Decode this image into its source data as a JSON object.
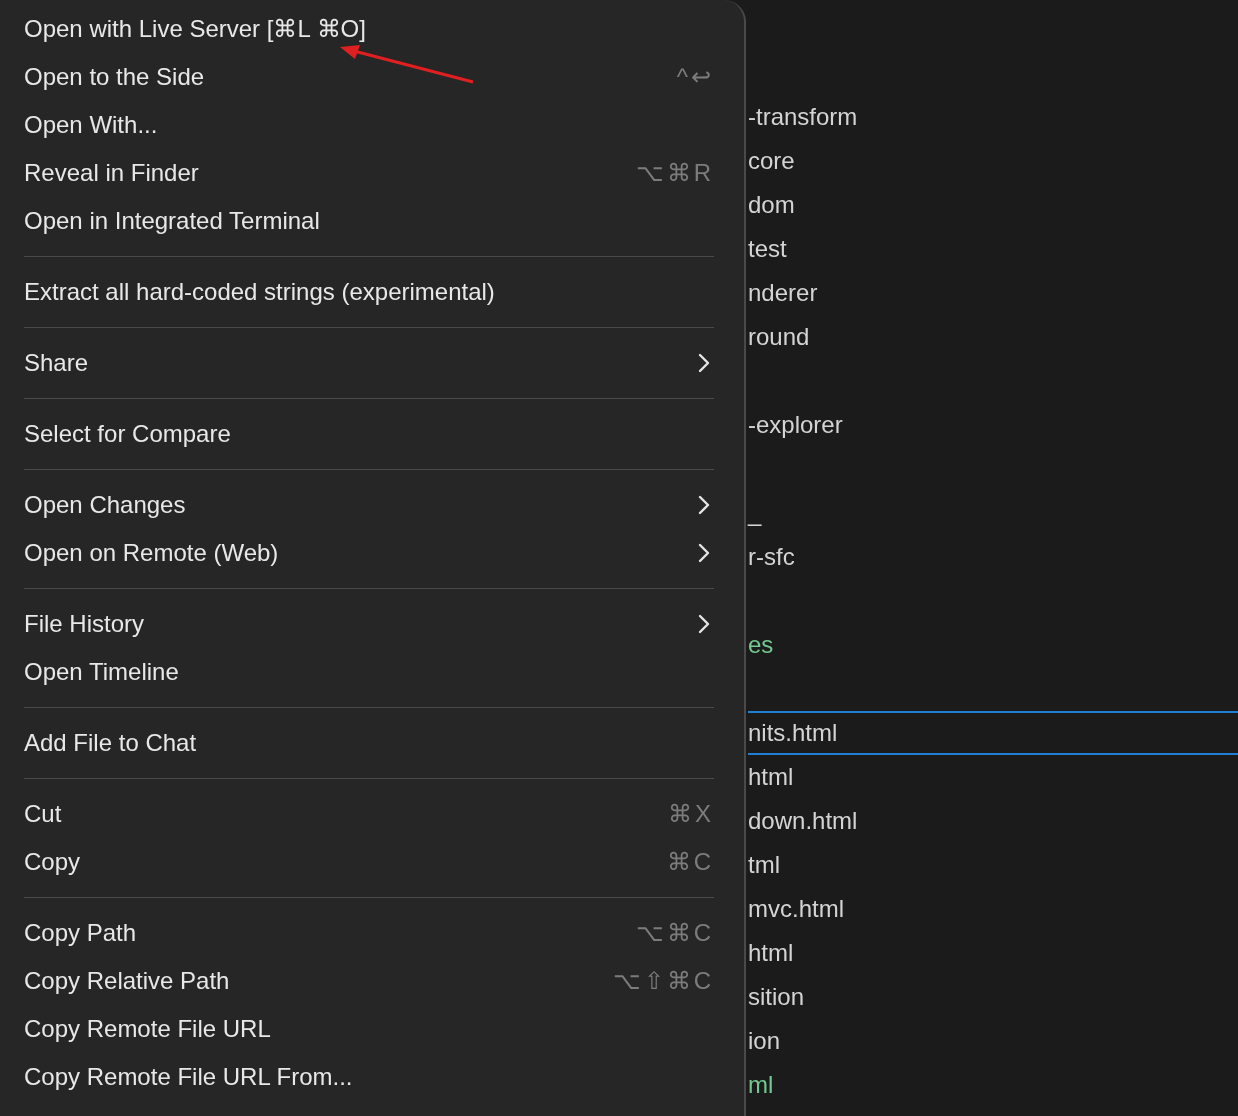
{
  "context_menu": {
    "groups": [
      [
        {
          "label": "Open with Live Server [⌘L ⌘O]"
        },
        {
          "label": "Open to the Side",
          "shortcut": "^↩"
        },
        {
          "label": "Open With..."
        },
        {
          "label": "Reveal in Finder",
          "shortcut": "⌥⌘R"
        },
        {
          "label": "Open in Integrated Terminal"
        }
      ],
      [
        {
          "label": "Extract all hard-coded strings (experimental)"
        }
      ],
      [
        {
          "label": "Share",
          "submenu": true
        }
      ],
      [
        {
          "label": "Select for Compare"
        }
      ],
      [
        {
          "label": "Open Changes",
          "submenu": true
        },
        {
          "label": "Open on Remote (Web)",
          "submenu": true
        }
      ],
      [
        {
          "label": "File History",
          "submenu": true
        },
        {
          "label": "Open Timeline"
        }
      ],
      [
        {
          "label": "Add File to Chat"
        }
      ],
      [
        {
          "label": "Cut",
          "shortcut": "⌘X"
        },
        {
          "label": "Copy",
          "shortcut": "⌘C"
        }
      ],
      [
        {
          "label": "Copy Path",
          "shortcut": "⌥⌘C"
        },
        {
          "label": "Copy Relative Path",
          "shortcut": "⌥⇧⌘C"
        },
        {
          "label": "Copy Remote File URL"
        },
        {
          "label": "Copy Remote File URL From..."
        }
      ]
    ]
  },
  "explorer": {
    "items": [
      {
        "kind": "covered"
      },
      {
        "kind": "file",
        "label": "-transform",
        "selected": false
      },
      {
        "kind": "file",
        "label": "core",
        "selected": false
      },
      {
        "kind": "file",
        "label": "dom",
        "selected": false
      },
      {
        "kind": "file",
        "label": "test",
        "selected": false
      },
      {
        "kind": "file",
        "label": "nderer",
        "selected": false
      },
      {
        "kind": "file",
        "label": "round",
        "selected": false
      },
      {
        "kind": "covered"
      },
      {
        "kind": "file",
        "label": "-explorer",
        "selected": false
      },
      {
        "kind": "covered"
      },
      {
        "kind": "file",
        "label": "_",
        "selected": false
      },
      {
        "kind": "file",
        "label": "r-sfc",
        "selected": false
      },
      {
        "kind": "covered"
      },
      {
        "kind": "file",
        "label": "es",
        "color": "#73c991",
        "selected": false
      },
      {
        "kind": "covered"
      },
      {
        "kind": "file",
        "label": "nits.html",
        "selected": true
      },
      {
        "kind": "file",
        "label": "html",
        "selected": false
      },
      {
        "kind": "file",
        "label": "down.html",
        "selected": false
      },
      {
        "kind": "file",
        "label": "tml",
        "selected": false
      },
      {
        "kind": "file",
        "label": "mvc.html",
        "selected": false
      },
      {
        "kind": "file",
        "label": "html",
        "selected": false
      },
      {
        "kind": "file",
        "label": "sition",
        "selected": false
      },
      {
        "kind": "file",
        "label": "ion",
        "selected": false
      },
      {
        "kind": "file",
        "label": "ml",
        "color": "#73c991",
        "selected": false
      }
    ]
  }
}
